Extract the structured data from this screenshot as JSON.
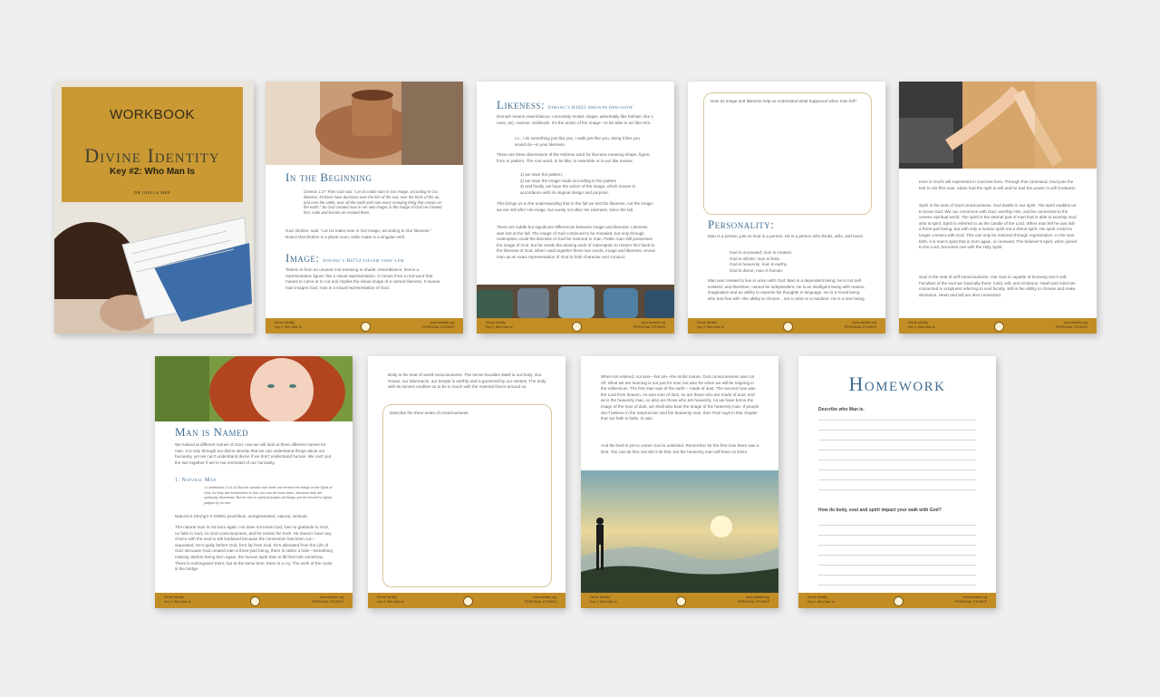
{
  "cover": {
    "workbook": "WORKBOOK",
    "title": "Divine Identity",
    "subtitle": "Key #2: Who Man Is",
    "author": "DR JOELLE MEE"
  },
  "footer": {
    "left": "Divine Identity\nKey 2: Who Man Is",
    "right": "www.website.org\nPERSONAL STUDIES"
  },
  "p2": {
    "heading1": "In the Beginning",
    "verse": "Genesis 1:27 Then God said, “Let Us make man in Our image, according to Our likeness; let them have dominion over the fish of the sea, over the birds of the air, and over the cattle, over all the earth and over every creeping thing that creeps on the earth.” So God created man in His own image; in the image of God He created him; male and female He created them.",
    "para1": "God, Elohim, said, “Let Us make man in Our image, according to Our likeness.” Notice that Elohim is a plural noun, while make is a singular verb.",
    "heading2": "Image:",
    "heading2_small": "Strong’s H6754 tselem tseh'-lem",
    "para2": "Tselem is from an unused root meaning to shade; resemblance; hence a representative figure, like a visual representation. It comes from a root word that means to carve or to cut and implies the visual image of a carved likeness. It means man images God; man is a visual representation of God."
  },
  "p3": {
    "heading": "Likeness:",
    "heading_small": "Strong’s H1823 dmuwth dem-ooth'",
    "para1": "Demuth means resemblance; concretely model, shape; adverbially like fashion, like (-ness, as), manner, similitude. It’s the action of the image—to be able to act like Him.",
    "quote": "i.e., I do something just like you. I walk just like you, doing it like you would do—in your likeness.",
    "para2": "There are three dimensions of the Hebrew word for likeness meaning shape, figure, from or pattern. The root word, to be like, to resemble or to act like means:",
    "list": "1) we have the pattern;\n2) we have the image made according to the pattern\n3) and finally, we have the action of the image, which moves in accordance with its original design and purpose.",
    "para3": "This brings us to the understanding that in the fall we lost the likeness, not the image; we are still after His image, but surely not after His Likeness, since the fall.",
    "para4": "There are subtle but significant differences between image and likeness. Likeness was lost at the fall. The image of God continued to be revealed, but only through redemption could the likeness of God be restored to man. Fallen man still possesses the image of God, but he needs the atoning work of redemption to restore him back to the likeness of God. When used together these two words, image and likeness, reveal man as an exact representation of God in both character and conduct."
  },
  "p4": {
    "question": "How do image and likeness help us understand what happened when man fell?",
    "heading": "Personality:",
    "para1": "Man is a person, just as God is a person. He is a person who thinks, wills, and loves.",
    "list": "God is uncreated; man is created.\nGod is infinite; man is finite.\nGod is heavenly; man is earthy.\nGod is divine; man is human.",
    "para2": "Man was created to live in union with God. Man is a dependent being; he is not self-existent; and therefore, cannot be independent. He is an intelligent being with reason, imagination and an ability to express his thoughts in language. He is a moral being who has free will—the ability to choose…not a robot or a machine. He is a love being."
  },
  "p5": {
    "para1": "Here is God’s will expressed in concrete form. Through this command, God puts the test to His first man. Adam had the right to will and he had the power to will Godward.",
    "para2": "Spirit is the seat of God-consciousness. God dwells in our spirit. The spirit enables us to know God. We can commune with God, worship Him, and be connected to the unseen spiritual world. The spirit is the eternal part of man that is able to worship God who is spirit. Spirit is referred to as the candle of the Lord. When man fell he was still a three-part being, but with only a human spirit not a divine spirit. His spirit could no longer connect with God. This can only be restored through regeneration. In the new birth, it is man’s spirit that is born again, or renewed. The believer’s spirit, when joined to the Lord, becomes one with the Holy Spirit.",
    "para3": "Soul is the seat of self-consciousness. Our soul is capable of knowing one’s self. Faculties of the soul are basically three: mind, will, and emotions. Heart and mind are connected in scriptures referring to soul faculty. Will is the ability to choose and make decisions. Heart and will are also connected."
  },
  "p6": {
    "heading": "Man is Named",
    "para1": "We looked at different names of God, now we will look at three different names for man. It is only through our divine identity that we can understand things about our humanity, yet we can’t understand divine if we don’t understand human. We can’t put the two together if we’re not reminded of our humanity.",
    "sub": "1. Natural Man",
    "verse": "1 Corinthians 2:14-15 But the natural man does not receive the things of the Spirit of God, for they are foolishness to him; nor can he know them, because they are spiritually discerned. But he who is spiritual judges all things, yet he himself is rightly judged by no one.",
    "para2": "Natural is Strong’s # G5591 psuchikos, unregenerated, natural, sensual.",
    "para3": "The natural man is not born again. He does not know God, has no gratitude to God, no faith in God, no God consciousness, and he resists the truth. He doesn’t have any choice with the soul to will Godward because the connection has been cut—separated. He’s guilty before God, he’s far from God, he’s alienated from the Life of God. Because God created man a three-part being, there is rather a hole—something missing. Before being born again, the human spirit tries to fill that hole somehow. There is nothingness there; but at the same time, there is a cry. The work of the cross is the bridge."
  },
  "p7": {
    "para1": "Body is the seat of world-consciousness. The sense faculties dwell in our body. Our House, our tabernacle, our temple is earthly and is governed by our senses. The body with its senses enables us to be in touch with the material that is around us.",
    "question": "Describe the three seats of consciousness."
  },
  "p8": {
    "para1": "When sin entered, not sins—but sin—the sinful nature, God consciousness was cut off. What we are learning is not just for now, but also for when we will be reigning in the millennium. The first man was of the earth – made of dust. The second man was the Lord from heaven. As was man of dust, so are those who are made of dust; and as is the heavenly man, so also are those who are heavenly. As we have borne the image of the man of dust, we shall also bear the image of the heavenly man. If people don’t believe in the resurrection and the heavenly man, then Paul says in this chapter that our faith is futile, in vain.",
    "para2": "And the best is yet to come! God is unlimited. Remember for the first man there was a limit. You can do this, but don’t do that, but the heavenly man will have no limits."
  },
  "p9": {
    "heading": "Homework",
    "q1": "Describe who Man is.",
    "q2": "How do body, soul and spirit impact your walk with God?"
  }
}
